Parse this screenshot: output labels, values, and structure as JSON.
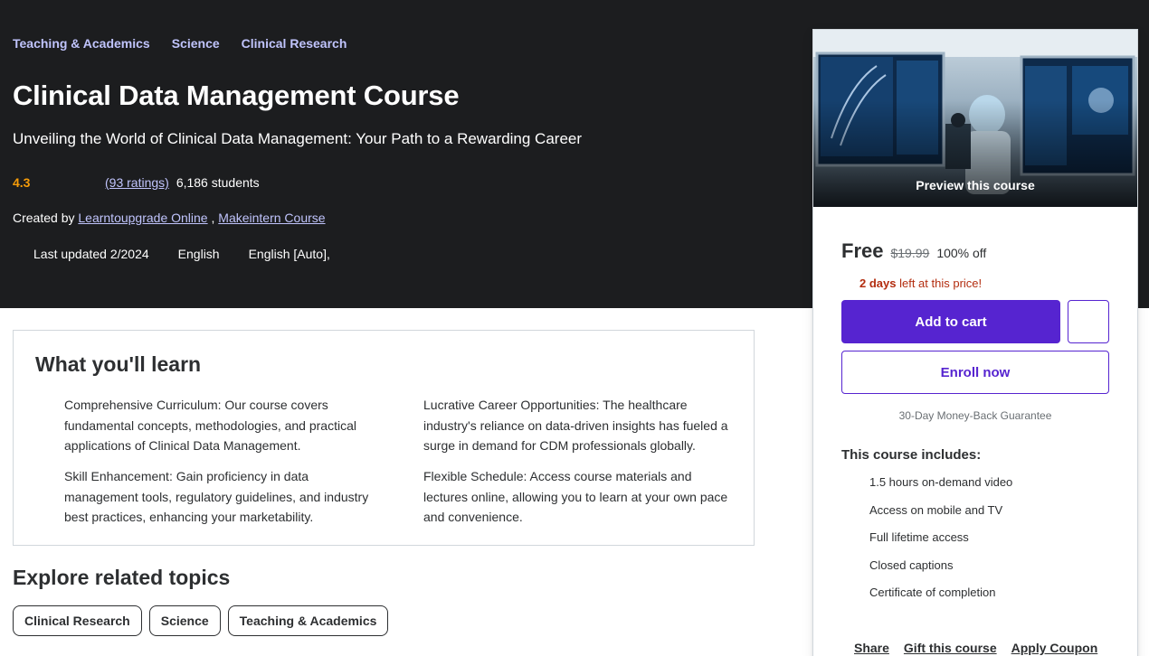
{
  "breadcrumb": [
    "Teaching & Academics",
    "Science",
    "Clinical Research"
  ],
  "course": {
    "title": "Clinical Data Management Course",
    "subtitle": "Unveiling the World of Clinical Data Management: Your Path to a Rewarding Career",
    "rating": "4.3",
    "ratings_count": "(93 ratings)",
    "students": "6,186 students",
    "created_by_label": "Created by",
    "instructors": [
      "Learntoupgrade Online",
      "Makeintern Course"
    ],
    "instructor_separator": " , ",
    "last_updated": "Last updated 2/2024",
    "language": "English",
    "captions": "English [Auto],"
  },
  "sidebar": {
    "preview_label": "Preview this course",
    "price_current": "Free",
    "price_original": "$19.99",
    "discount": "100% off",
    "countdown_bold": "2 days",
    "countdown_rest": " left at this price!",
    "add_to_cart": "Add to cart",
    "enroll": "Enroll now",
    "guarantee": "30-Day Money-Back Guarantee",
    "includes_title": "This course includes:",
    "includes": [
      "1.5 hours on-demand video",
      "Access on mobile and TV",
      "Full lifetime access",
      "Closed captions",
      "Certificate of completion"
    ],
    "share": "Share",
    "gift": "Gift this course",
    "coupon": "Apply Coupon"
  },
  "learn": {
    "title": "What you'll learn",
    "items": [
      "Comprehensive Curriculum: Our course covers fundamental concepts, methodologies, and practical applications of Clinical Data Management.",
      "Lucrative Career Opportunities: The healthcare industry's reliance on data-driven insights has fueled a surge in demand for CDM professionals globally.",
      "Skill Enhancement: Gain proficiency in data management tools, regulatory guidelines, and industry best practices, enhancing your marketability.",
      "Flexible Schedule: Access course materials and lectures online, allowing you to learn at your own pace and convenience."
    ]
  },
  "explore": {
    "title": "Explore related topics",
    "topics": [
      "Clinical Research",
      "Science",
      "Teaching & Academics"
    ]
  }
}
